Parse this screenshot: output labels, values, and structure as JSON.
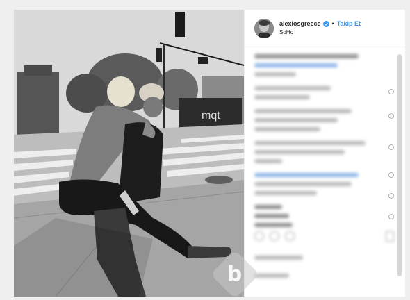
{
  "post": {
    "username": "alexiosgreece",
    "separator": "•",
    "follow_label": "Takip Et",
    "location": "SoHo"
  },
  "photo": {
    "truck_sign": "mqt"
  },
  "icons": {
    "verified": "verified-badge-icon",
    "watermark": "watermark-logo"
  },
  "colors": {
    "follow_blue": "#3897f0",
    "verified_blue": "#3897f0",
    "text_dark": "#262626"
  }
}
